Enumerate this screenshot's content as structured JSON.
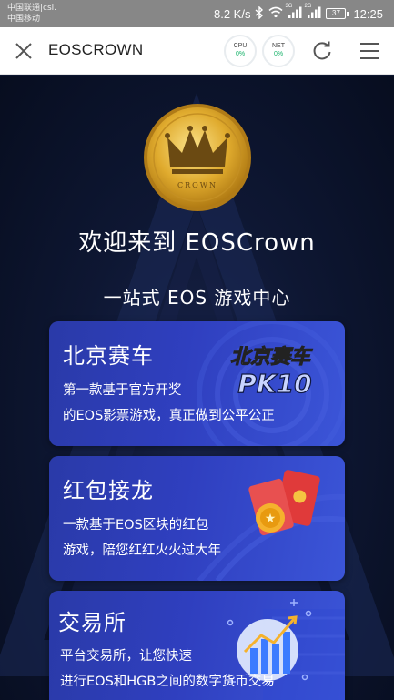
{
  "status_bar": {
    "carrier_1": "中国联通|csl.",
    "carrier_2": "中国移动",
    "speed": "8.2 K/s",
    "net_1": "3G",
    "net_2": "2G",
    "battery": "37",
    "time": "12:25"
  },
  "app_bar": {
    "title": "EOSCROWN",
    "cpu": {
      "label": "CPU",
      "value": "0%"
    },
    "net": {
      "label": "NET",
      "value": "0%"
    }
  },
  "hero": {
    "coin_text": "CROWN",
    "welcome": "欢迎来到 EOSCrown",
    "subtitle": "一站式 EOS 游戏中心"
  },
  "cards": [
    {
      "title": "北京赛车",
      "desc_1": "第一款基于官方开奖",
      "desc_2": "的EOS影票游戏，真正做到公平公正",
      "art_text_1": "北京赛车",
      "art_text_2": "PK10"
    },
    {
      "title": "红包接龙",
      "desc_1": "一款基于EOS区块的红包",
      "desc_2": "游戏，陪您红红火火过大年"
    },
    {
      "title": "交易所",
      "desc_1": "平台交易所，让您快速",
      "desc_2": "进行EOS和HGB之间的数字货币交易"
    }
  ],
  "icons": {
    "close": "close-icon",
    "refresh": "refresh-icon",
    "menu": "menu-icon",
    "bluetooth": "bluetooth-icon",
    "wifi": "wifi-icon",
    "signal": "signal-icon",
    "battery": "battery-icon"
  },
  "colors": {
    "status_bar": "#878787",
    "app_bar": "#ffffff",
    "background": "#0b1530",
    "card": "#2f3fbf",
    "gauge_value": "#19b36b",
    "coin_gold": "#d9a82a"
  }
}
